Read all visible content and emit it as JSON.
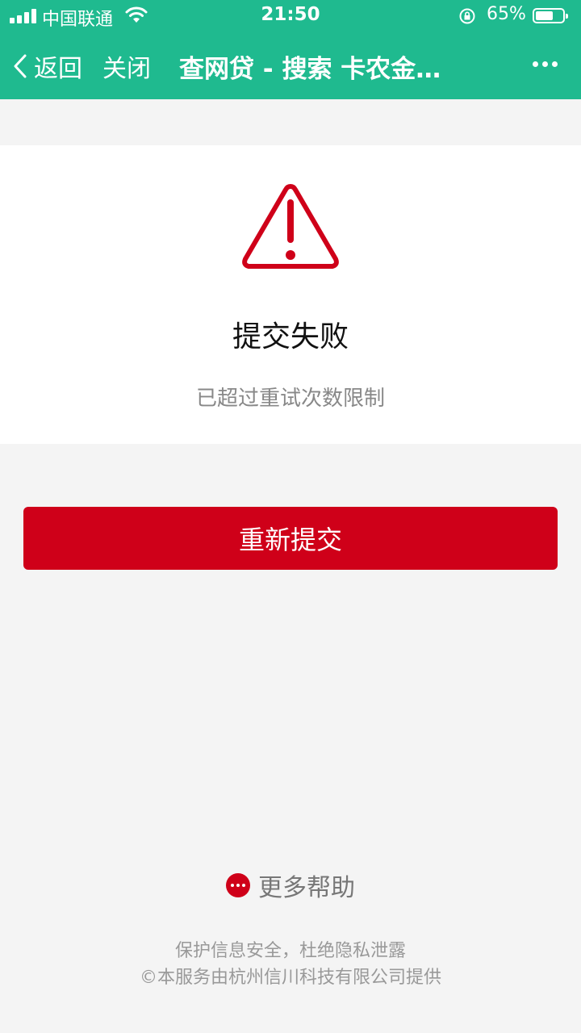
{
  "status_bar": {
    "carrier": "中国联通",
    "time": "21:50",
    "battery_percent_text": "65%",
    "battery_level": 0.65
  },
  "navbar": {
    "back_label": "返回",
    "close_label": "关闭",
    "title": "查网贷 - 搜索 卡农金…"
  },
  "result": {
    "title": "提交失败",
    "description": "已超过重试次数限制"
  },
  "actions": {
    "resubmit_label": "重新提交"
  },
  "help": {
    "label": "更多帮助"
  },
  "footer": {
    "line1": "保护信息安全，杜绝隐私泄露",
    "line2": "©本服务由杭州信川科技有限公司提供"
  },
  "colors": {
    "header_green": "#1fba8f",
    "alert_red": "#cf0019",
    "page_bg": "#f4f4f4"
  }
}
